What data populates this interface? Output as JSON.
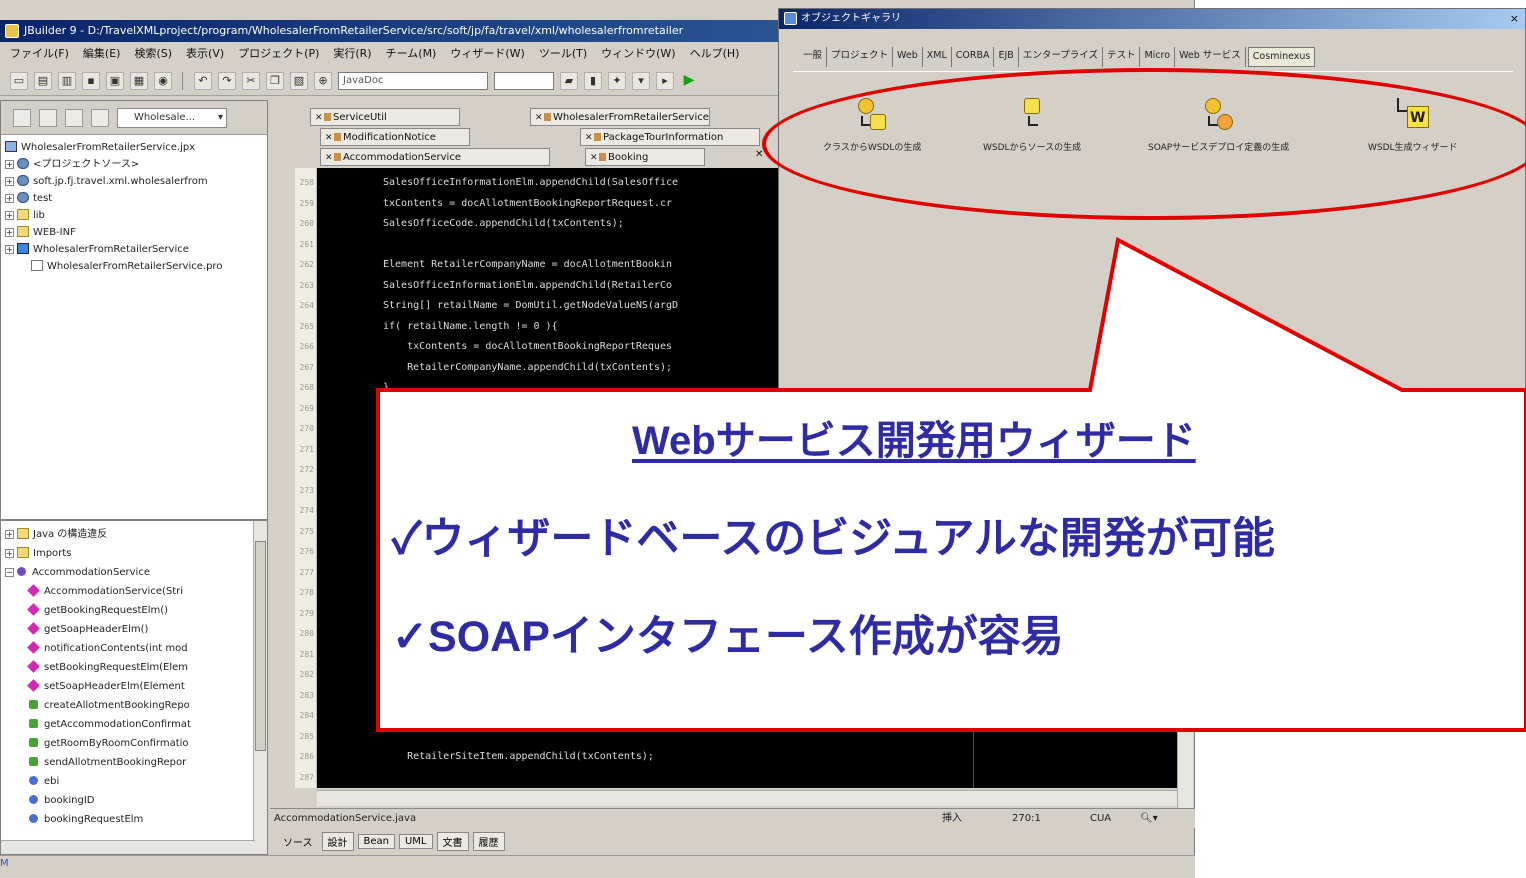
{
  "ide": {
    "title": "JBuilder 9 - D:/TravelXMLproject/program/WholesalerFromRetailerService/src/soft/jp/fa/travel/xml/wholesalerfromretailer",
    "menu": [
      "ファイル(F)",
      "編集(E)",
      "検索(S)",
      "表示(V)",
      "プロジェクト(P)",
      "実行(R)",
      "チーム(M)",
      "ウィザード(W)",
      "ツール(T)",
      "ウィンドウ(W)",
      "ヘルプ(H)"
    ],
    "toolbar_search": "JavaDoc",
    "project_combo": "Wholesale...",
    "project_tree": [
      {
        "label": "WholesalerFromRetailerService.jpx",
        "icon": "project-icon",
        "expander": ""
      },
      {
        "label": "<プロジェクトソース>",
        "icon": "package-icon",
        "expander": "+"
      },
      {
        "label": "soft.jp.fj.travel.xml.wholesalerfrom",
        "icon": "package-icon",
        "expander": "+"
      },
      {
        "label": "test",
        "icon": "package-icon",
        "expander": "+"
      },
      {
        "label": "lib",
        "icon": "folder-icon",
        "expander": "+"
      },
      {
        "label": "WEB-INF",
        "icon": "folder-icon",
        "expander": "+"
      },
      {
        "label": "WholesalerFromRetailerService",
        "icon": "webapp-icon",
        "expander": "+"
      },
      {
        "label": "WholesalerFromRetailerService.pro",
        "icon": "file-icon",
        "expander": ""
      }
    ],
    "structure_tree": [
      {
        "label": "Java の構造違反",
        "kind": "folder-icon",
        "indent": 0,
        "expander": "+"
      },
      {
        "label": "Imports",
        "kind": "folder-icon",
        "indent": 0,
        "expander": "+"
      },
      {
        "label": "AccommodationService",
        "kind": "class-icon",
        "indent": 0,
        "expander": "−"
      },
      {
        "label": "AccommodationService(Stri",
        "kind": "method-icon",
        "indent": 1
      },
      {
        "label": "getBookingRequestElm()",
        "kind": "method-icon",
        "indent": 1
      },
      {
        "label": "getSoapHeaderElm()",
        "kind": "method-icon",
        "indent": 1
      },
      {
        "label": "notificationContents(int mod",
        "kind": "method-icon",
        "indent": 1
      },
      {
        "label": "setBookingRequestElm(Elem",
        "kind": "method-icon",
        "indent": 1
      },
      {
        "label": "setSoapHeaderElm(Element",
        "kind": "method-icon",
        "indent": 1
      },
      {
        "label": "createAllotmentBookingRepo",
        "kind": "public-method-icon",
        "indent": 1
      },
      {
        "label": "getAccommodationConfirmat",
        "kind": "public-method-icon",
        "indent": 1
      },
      {
        "label": "getRoomByRoomConfirmatio",
        "kind": "public-method-icon",
        "indent": 1
      },
      {
        "label": "sendAllotmentBookingRepor",
        "kind": "public-method-icon",
        "indent": 1
      },
      {
        "label": "ebi",
        "kind": "field-icon",
        "indent": 1
      },
      {
        "label": "bookingID",
        "kind": "field-icon",
        "indent": 1
      },
      {
        "label": "bookingRequestElm",
        "kind": "field-icon",
        "indent": 1
      }
    ],
    "tabs": [
      {
        "label": "ServiceUtil"
      },
      {
        "label": "WholesalerFromRetailerService"
      },
      {
        "label": "ModificationNotice"
      },
      {
        "label": "PackageTourInformation"
      },
      {
        "label": "AccommodationService"
      },
      {
        "label": "Booking"
      }
    ],
    "code_lines": [
      "SalesOfficeInformationElm.appendChild(SalesOffice",
      "txContents = docAllotmentBookingReportRequest.cr",
      "SalesOfficeCode.appendChild(txContents);",
      "",
      "Element RetailerCompanyName = docAllotmentBookin",
      "SalesOfficeInformationElm.appendChild(RetailerCo",
      "String[] retailName = DomUtil.getNodeValueNS(argD",
      "if( retailName.length != 0 ){",
      "    txContents = docAllotmentBookingReportReques",
      "    RetailerCompanyName.appendChild(txContents);",
      "}",
      "",
      "",
      "",
      "",
      "",
      "",
      "",
      "",
      "",
      "",
      "",
      "",
      "",
      "",
      "",
      "",
      "",
      "    RetailerSiteItem.appendChild(txContents);"
    ],
    "line_numbers": [
      "258",
      "259",
      "260",
      "261",
      "262",
      "263",
      "264",
      "265",
      "266",
      "267",
      "268",
      "269",
      "270",
      "271",
      "272",
      "273",
      "274",
      "275",
      "276",
      "277",
      "278",
      "279",
      "280",
      "281",
      "282",
      "283",
      "284",
      "285",
      "286",
      "287"
    ],
    "status": {
      "file": "AccommodationService.java",
      "mode": "挿入",
      "pos": "270:1",
      "encoding": "CUA"
    },
    "bottom_tabs": [
      "ソース",
      "設計",
      "Bean",
      "UML",
      "文書",
      "履歴"
    ],
    "bottom_mark": "M"
  },
  "gallery": {
    "title": "オブジェクトギャラリ",
    "close": "×",
    "tabs": [
      "一般",
      "プロジェクト",
      "Web",
      "XML",
      "CORBA",
      "EJB",
      "エンタープライズ",
      "テスト",
      "Micro",
      "Web サービス",
      "Cosminexus"
    ],
    "active_tab": "Cosminexus",
    "items": [
      {
        "label": "クラスからWSDLの生成",
        "icon": "class-to-wsdl-icon"
      },
      {
        "label": "WSDLからソースの生成",
        "icon": "wsdl-to-source-icon"
      },
      {
        "label": "SOAPサービスデプロイ定義の生成",
        "icon": "soap-deploy-icon"
      },
      {
        "label": "WSDL生成ウィザード",
        "icon": "wsdl-wizard-icon"
      }
    ]
  },
  "callout": {
    "title": "Webサービス開発用ウィザード",
    "bullets": [
      "✓ウィザードベースのビジュアルな開発が可能",
      "✓SOAPインタフェース作成が容易"
    ],
    "accent_color": "#e00000",
    "text_color": "#2f2ba3"
  }
}
